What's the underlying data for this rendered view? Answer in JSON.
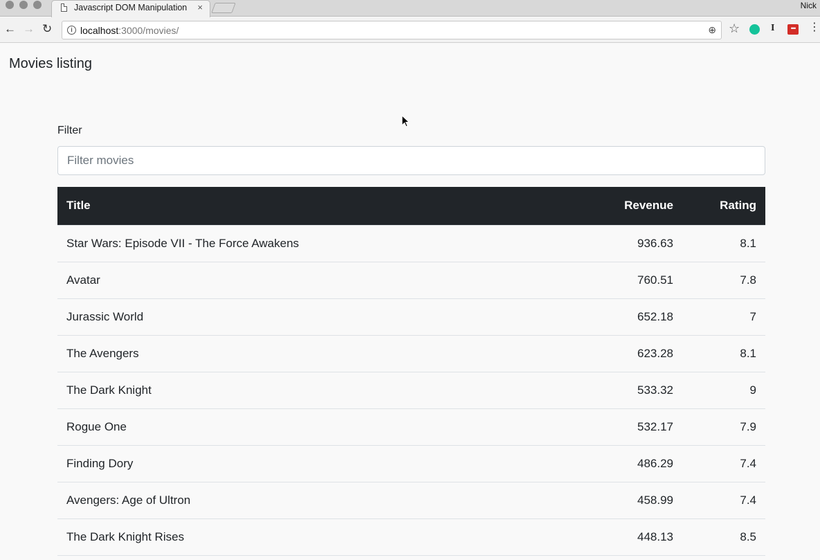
{
  "browser": {
    "tab_title": "Javascript DOM Manipulation",
    "tab_close": "×",
    "profile_name": "Nick",
    "url_host": "localhost",
    "url_path": ":3000/movies/",
    "info_glyph": "i",
    "back_glyph": "←",
    "forward_glyph": "→",
    "reload_glyph": "↻",
    "star_glyph": "☆",
    "zoom_glyph": "⊕",
    "ibeam_glyph": "I",
    "lastpass_glyph": "•••",
    "menu_glyph": "⋮",
    "colors": {
      "grammarly": "#15c39a",
      "lastpass": "#d32d27"
    }
  },
  "page": {
    "title": "Movies listing",
    "filter": {
      "label": "Filter",
      "placeholder": "Filter movies",
      "value": ""
    },
    "table": {
      "headers": {
        "title": "Title",
        "revenue": "Revenue",
        "rating": "Rating"
      },
      "header_bg": "#212529",
      "rows": [
        {
          "title": "Star Wars: Episode VII - The Force Awakens",
          "revenue": "936.63",
          "rating": "8.1"
        },
        {
          "title": "Avatar",
          "revenue": "760.51",
          "rating": "7.8"
        },
        {
          "title": "Jurassic World",
          "revenue": "652.18",
          "rating": "7"
        },
        {
          "title": "The Avengers",
          "revenue": "623.28",
          "rating": "8.1"
        },
        {
          "title": "The Dark Knight",
          "revenue": "533.32",
          "rating": "9"
        },
        {
          "title": "Rogue One",
          "revenue": "532.17",
          "rating": "7.9"
        },
        {
          "title": "Finding Dory",
          "revenue": "486.29",
          "rating": "7.4"
        },
        {
          "title": "Avengers: Age of Ultron",
          "revenue": "458.99",
          "rating": "7.4"
        },
        {
          "title": "The Dark Knight Rises",
          "revenue": "448.13",
          "rating": "8.5"
        }
      ]
    }
  }
}
